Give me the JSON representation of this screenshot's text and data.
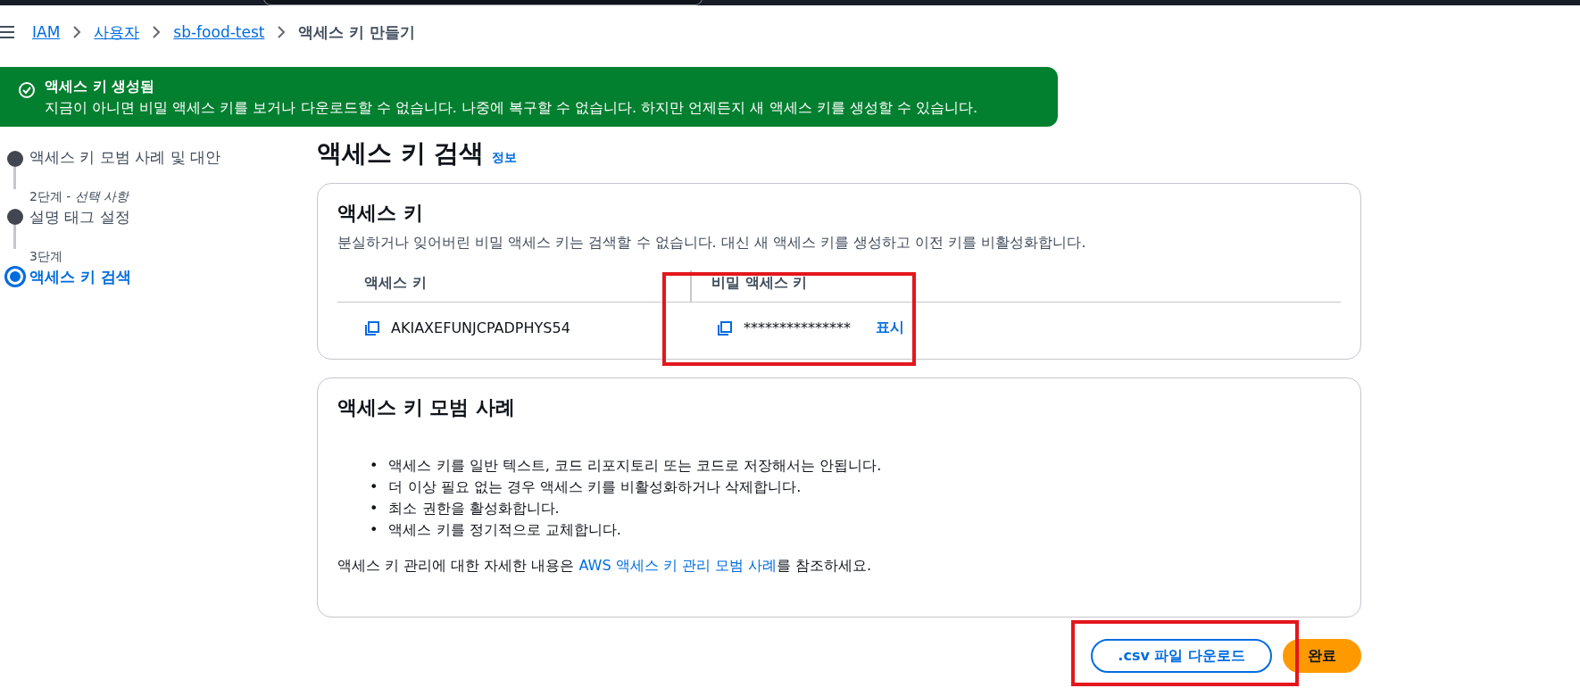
{
  "breadcrumb": [
    {
      "label": "IAM",
      "link": true
    },
    {
      "label": "사용자",
      "link": true
    },
    {
      "label": "sb-food-test",
      "link": true
    },
    {
      "label": "액세스 키 만들기",
      "link": false
    }
  ],
  "flash": {
    "kind": "success",
    "title": "액세스 키 생성됨",
    "message": "지금이 아니면 비밀 액세스 키를 보거나 다운로드할 수 없습니다. 나중에 복구할 수 없습니다. 하지만 언제든지 새 액세스 키를 생성할 수 있습니다."
  },
  "steps": [
    {
      "label": "액세스 키 모범 사례 및 대안",
      "selected": false
    },
    {
      "caption": "2단계 - ",
      "optional": "선택 사항",
      "label": "설명 태그 설정",
      "selected": false
    },
    {
      "caption": "3단계",
      "label": "액세스 키 검색",
      "selected": true
    }
  ],
  "page_title": "액세스 키 검색",
  "info_link": "정보",
  "keys_card": {
    "title": "액세스 키",
    "description": "분실하거나 잊어버린 비밀 액세스 키는 검색할 수 없습니다. 대신 새 액세스 키를 생성하고 이전 키를 비활성화합니다.",
    "columns": [
      "액세스 키",
      "비밀 액세스 키"
    ],
    "access_key": "AKIAXEFUNJCPADPHYS54",
    "secret": "***************",
    "show_link": "표시"
  },
  "practices_card": {
    "title": "액세스 키 모범 사례",
    "bullet": "•",
    "items": [
      "액세스 키를 일반 텍스트, 코드 리포지토리 또는 코드로 저장해서는 안됩니다.",
      "더 이상 필요 없는 경우 액세스 키를 비활성화하거나 삭제합니다.",
      "최소 권한을 활성화합니다.",
      "액세스 키를 정기적으로 교체합니다."
    ],
    "note_before": "액세스 키 관리에 대한 자세한 내용은 ",
    "note_link": "AWS 액세스 키 관리 모범 사례",
    "note_after": "를 참조하세요."
  },
  "buttons": [
    {
      "label": ".csv 파일 다운로드",
      "kind": "secondary"
    },
    {
      "label": "완료",
      "kind": "primary"
    }
  ]
}
